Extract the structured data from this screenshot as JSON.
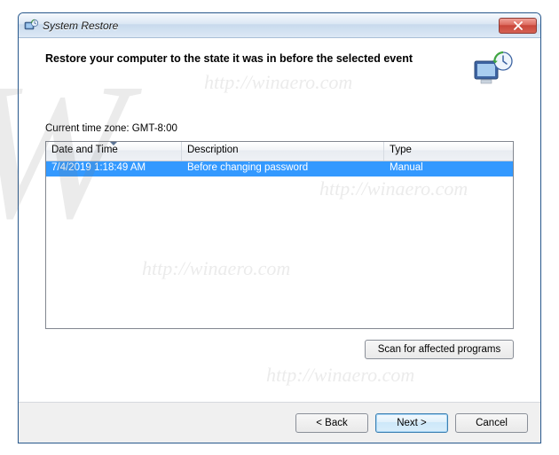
{
  "window": {
    "title": "System Restore"
  },
  "heading": "Restore your computer to the state it was in before the selected event",
  "timezone_label": "Current time zone: GMT-8:00",
  "table": {
    "columns": {
      "date": "Date and Time",
      "desc": "Description",
      "type": "Type"
    },
    "rows": [
      {
        "date": "7/4/2019 1:18:49 AM",
        "desc": "Before changing password",
        "type": "Manual"
      }
    ]
  },
  "buttons": {
    "scan": "Scan for affected programs",
    "back": "< Back",
    "next": "Next >",
    "cancel": "Cancel"
  },
  "watermark": {
    "glyph": "W",
    "url": "http://winaero.com"
  }
}
